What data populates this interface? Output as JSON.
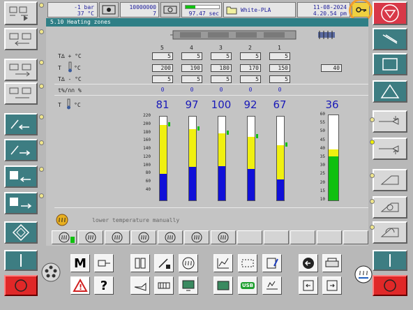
{
  "header": {
    "pressure": "-1 bar",
    "temperature": "37 °C",
    "counter_total": "10000000",
    "counter_current": "7",
    "cycle_time": "97.47 sec",
    "cycle_progress": 0.3,
    "material": "White-PLA",
    "date": "11-08-2024",
    "time": "4.20.54 pm"
  },
  "screen": {
    "title": "5.10 Heating zones",
    "zone_numbers": [
      "5",
      "4",
      "3",
      "2",
      "1"
    ],
    "row_labels": {
      "tol_plus": "T∆ + °C",
      "setpoint": "T",
      "setpoint_unit": "°C",
      "tol_minus": "T∆ - °C",
      "power": "t%/∩∩ %",
      "actual": "T",
      "actual_unit": "°C"
    },
    "tol_plus": [
      "5",
      "5",
      "5",
      "5",
      "5"
    ],
    "setpoints": [
      "200",
      "190",
      "180",
      "170",
      "150"
    ],
    "nozzle_setpoint": "40",
    "tol_minus": [
      "5",
      "5",
      "5",
      "5",
      "5"
    ],
    "power": [
      "0",
      "0",
      "0",
      "0",
      "0"
    ],
    "actual_temps": [
      "81",
      "97",
      "100",
      "92",
      "67"
    ],
    "oil_temp": "36",
    "scale_main": [
      "220",
      "200",
      "180",
      "160",
      "140",
      "120",
      "100",
      "80",
      "60",
      "40"
    ],
    "scale_oil": [
      "60",
      "55",
      "50",
      "45",
      "40",
      "35",
      "30",
      "25",
      "20",
      "15",
      "10"
    ],
    "message": "lower temperature manually"
  },
  "bottom": {
    "m_label": "M",
    "warning_label": "!",
    "help_label": "?",
    "usb_label": "USB"
  },
  "colors": {
    "teal": "#2f7f86",
    "highlight": "#f39c2b",
    "stop_red": "#e02828",
    "value_blue": "#1a1ab8"
  }
}
